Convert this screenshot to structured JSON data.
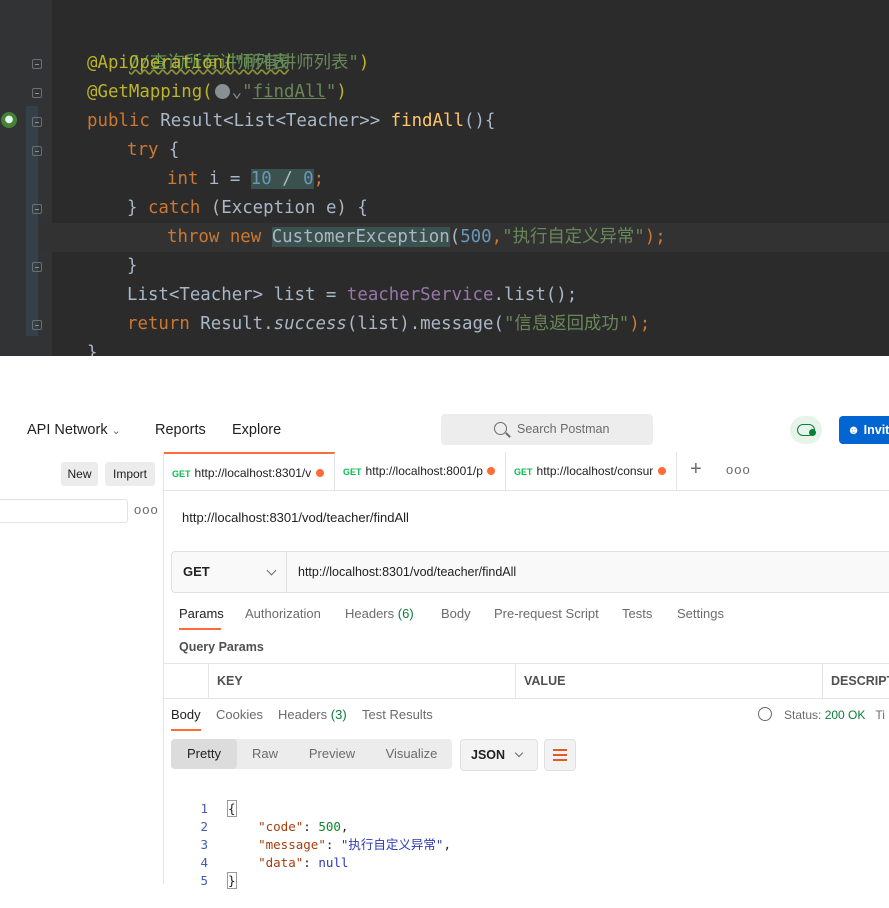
{
  "ide": {
    "lines": {
      "l1": "//查询所有讲师列表",
      "l2_ann": "@ApiOperation(",
      "l2_str": "\"所有讲师列表\"",
      "l2_end": ")",
      "l3_ann": "@GetMapping(",
      "l3_hint": "⌄",
      "l3_q1": "\"",
      "l3_link": "findAll",
      "l3_q2": "\"",
      "l3_end": ")",
      "l4_kw": "public ",
      "l4_type": "Result<List<Teacher>> ",
      "l4_fn": "findAll",
      "l4_end": "(){",
      "l5_kw": "try",
      "l5_end": " {",
      "l6_kw": "int ",
      "l6_var": "i = ",
      "l6_n1": "10",
      "l6_op": " / ",
      "l6_n2": "0",
      "l6_semi": ";",
      "l7_pre": "} ",
      "l7_kw": "catch",
      "l7_end": " (Exception e) {",
      "l8_kw": "throw new ",
      "l8_cls": "CustomerException",
      "l8_p": "(",
      "l8_num": "500",
      "l8_c": ",",
      "l8_str": "\"执行自定义异常\"",
      "l8_end": ");",
      "l9": "}",
      "l10_pre": "List<Teacher> list = ",
      "l10_field": "teacherService",
      "l10_end": ".list();",
      "l11_kw": "return ",
      "l11_a": "Result.",
      "l11_it": "success",
      "l11_b": "(list).message(",
      "l11_str": "\"信息返回成功\"",
      "l11_end": ");",
      "l12": "}"
    }
  },
  "postman": {
    "nav": {
      "api_network": "API Network",
      "reports": "Reports",
      "explore": "Explore"
    },
    "search": {
      "placeholder": "Search Postman"
    },
    "invite_label": "Invite",
    "sidebar": {
      "new": "New",
      "import": "Import",
      "more": "ooo"
    },
    "tabs": [
      {
        "method": "GET",
        "url": "http://localhost:8301/v"
      },
      {
        "method": "GET",
        "url": "http://localhost:8001/p"
      },
      {
        "method": "GET",
        "url": "http://localhost/consur"
      }
    ],
    "tab_add": "+",
    "tab_more": "ooo",
    "request_name": "http://localhost:8301/vod/teacher/findAll",
    "method": "GET",
    "url": "http://localhost:8301/vod/teacher/findAll",
    "request_tabs": {
      "params": "Params",
      "authorization": "Authorization",
      "headers": "Headers",
      "headers_count": "(6)",
      "body": "Body",
      "prerequest": "Pre-request Script",
      "tests": "Tests",
      "settings": "Settings"
    },
    "query_params_label": "Query Params",
    "params_columns": [
      "KEY",
      "VALUE",
      "DESCRIPT"
    ],
    "response_tabs": {
      "body": "Body",
      "cookies": "Cookies",
      "headers": "Headers",
      "headers_count": "(3)",
      "test_results": "Test Results"
    },
    "status": {
      "label": "Status:",
      "value": "200 OK",
      "time": "Ti"
    },
    "view_modes": [
      "Pretty",
      "Raw",
      "Preview",
      "Visualize"
    ],
    "format": "JSON",
    "response": {
      "line_numbers": [
        "1",
        "2",
        "3",
        "4",
        "5"
      ],
      "open": "{",
      "code_key": "\"code\"",
      "code_val": "500",
      "message_key": "\"message\"",
      "message_val": "\"执行自定义异常\"",
      "data_key": "\"data\"",
      "data_val": "null",
      "close": "}"
    }
  },
  "colors": {
    "postman_accent": "#ff6c37",
    "invite_blue": "#0265d2",
    "status_ok": "#0c7c3a"
  }
}
